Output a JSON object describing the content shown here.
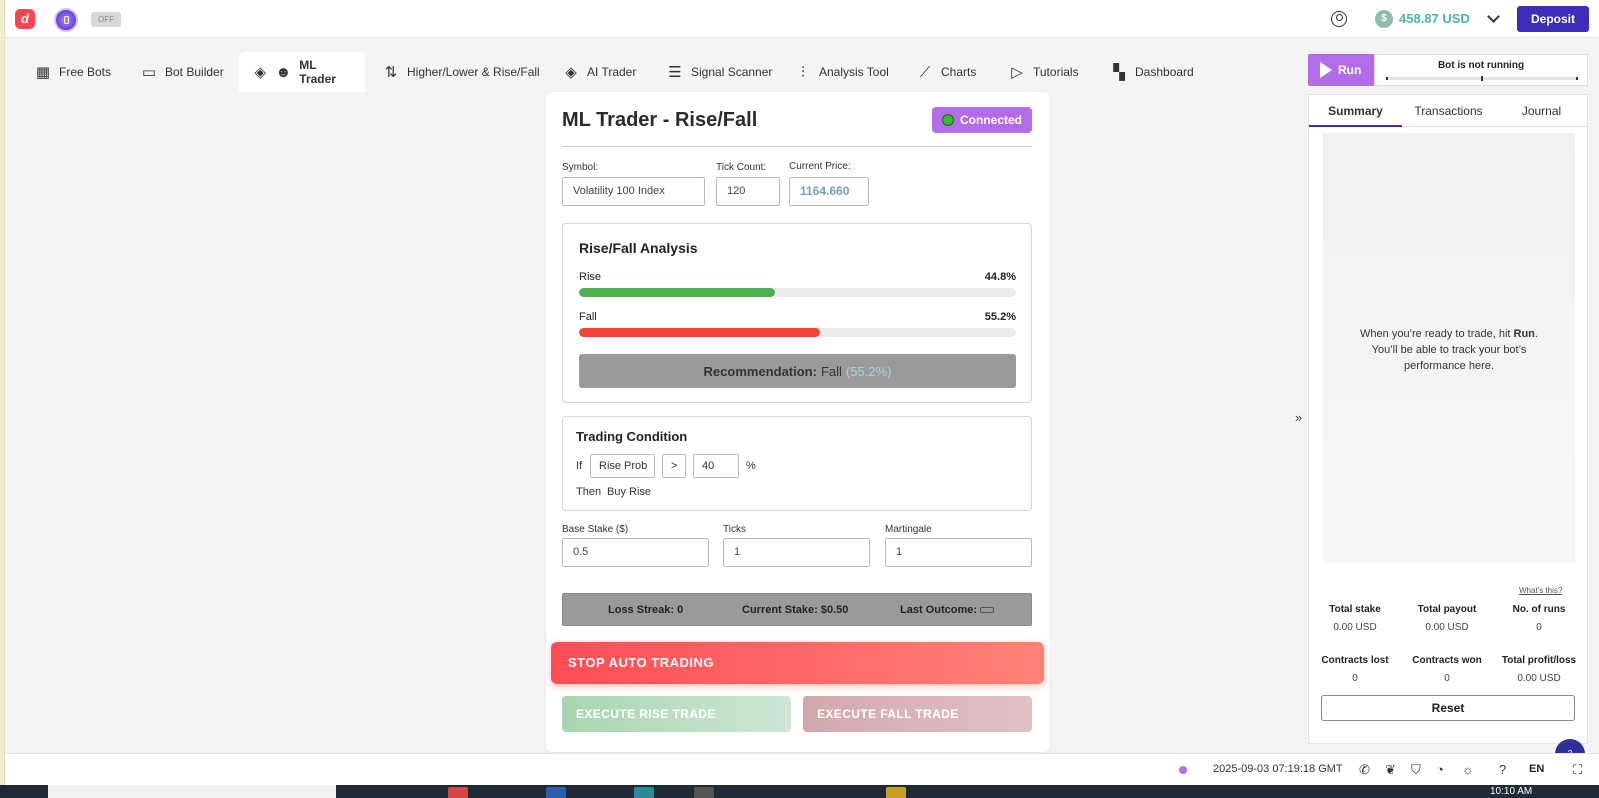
{
  "header": {
    "logo_letter": "d",
    "toggle_label": "OFF",
    "balance": "458.87 USD",
    "deposit_label": "Deposit"
  },
  "nav": {
    "tabs": [
      {
        "label": "Free Bots",
        "icon": "grid-plus-icon"
      },
      {
        "label": "Bot Builder",
        "icon": "builder-icon"
      },
      {
        "label": "ML Trader",
        "icon": "layers-icon",
        "active": true
      },
      {
        "label": "Higher/Lower & Rise/Fall",
        "icon": "arrows-updown-icon"
      },
      {
        "label": "AI Trader",
        "icon": "layers-icon"
      },
      {
        "label": "Signal Scanner",
        "icon": "list-icon"
      },
      {
        "label": "Analysis Tool",
        "icon": "sliders-icon"
      },
      {
        "label": "Charts",
        "icon": "chart-line-icon"
      },
      {
        "label": "Tutorials",
        "icon": "video-icon"
      },
      {
        "label": "Dashboard",
        "icon": "dashboard-icon"
      }
    ]
  },
  "trader": {
    "title": "ML Trader - Rise/Fall",
    "connection_status": "Connected",
    "symbol_label": "Symbol:",
    "symbol_value": "Volatility 100 Index",
    "tick_count_label": "Tick Count:",
    "tick_count_value": "120",
    "current_price_label": "Current Price:",
    "current_price_value": "1164.660",
    "analysis": {
      "title": "Rise/Fall Analysis",
      "rise_label": "Rise",
      "rise_pct": "44.8%",
      "rise_value": 44.8,
      "fall_label": "Fall",
      "fall_pct": "55.2%",
      "fall_value": 55.2,
      "recommendation_label": "Recommendation:",
      "recommendation_value": "Fall",
      "recommendation_pct": "(55.2%)"
    },
    "condition": {
      "title": "Trading Condition",
      "if_label": "If",
      "metric": "Rise Prob",
      "operator": ">",
      "threshold": "40",
      "unit": "%",
      "then_label": "Then",
      "action": "Buy Rise"
    },
    "base_stake_label": "Base Stake ($)",
    "base_stake_value": "0.5",
    "ticks_label": "Ticks",
    "ticks_value": "1",
    "martingale_label": "Martingale",
    "martingale_value": "1",
    "status": {
      "loss_streak": "Loss Streak: 0",
      "current_stake": "Current Stake: $0.50",
      "last_outcome": "Last Outcome:"
    },
    "stop_label": "STOP AUTO TRADING",
    "rise_trade_label": "EXECUTE RISE TRADE",
    "fall_trade_label": "EXECUTE FALL TRADE"
  },
  "run_panel": {
    "run_label": "Run",
    "bot_status": "Bot is not running",
    "tabs": [
      "Summary",
      "Transactions",
      "Journal"
    ],
    "empty_line1_pre": "When you’re ready to trade, hit ",
    "empty_line1_bold": "Run",
    "empty_line1_post": ".",
    "empty_line2": "You’ll be able to track your bot’s",
    "empty_line3": "performance here.",
    "whats_this": "What's this?",
    "stats": [
      {
        "label": "Total stake",
        "value": "0.00 USD"
      },
      {
        "label": "Total payout",
        "value": "0.00 USD"
      },
      {
        "label": "No. of runs",
        "value": "0"
      },
      {
        "label": "Contracts lost",
        "value": "0"
      },
      {
        "label": "Contracts won",
        "value": "0"
      },
      {
        "label": "Total profit/loss",
        "value": "0.00 USD"
      }
    ],
    "reset_label": "Reset"
  },
  "footer": {
    "timestamp": "2025-09-03 07:19:18 GMT",
    "language": "EN"
  },
  "taskbar": {
    "clock": "10:10 AM"
  },
  "colors": {
    "accent_purple": "#b36ce8",
    "deposit": "#3c2eb8",
    "rise": "#4caf50",
    "fall": "#f44336",
    "balance": "#4bb4b3"
  }
}
